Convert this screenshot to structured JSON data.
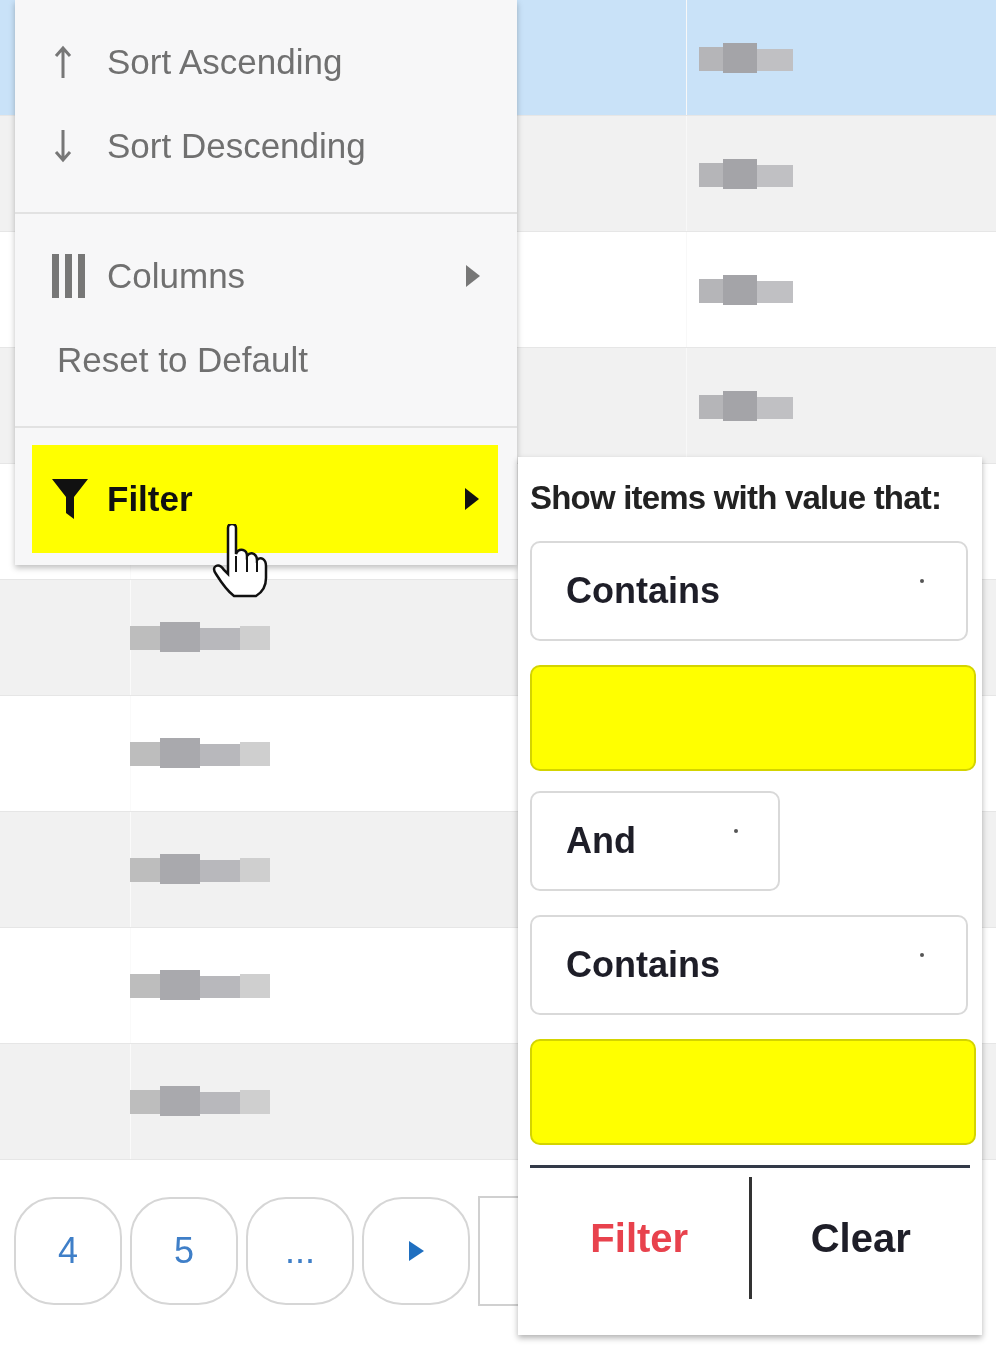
{
  "grid": {
    "rows": [
      {
        "selected": true
      },
      {
        "selected": false
      },
      {
        "selected": false
      },
      {
        "selected": false
      },
      {
        "selected": false
      },
      {
        "selected": false
      },
      {
        "selected": false
      },
      {
        "selected": false
      },
      {
        "selected": false
      },
      {
        "selected": false
      }
    ]
  },
  "column_menu": {
    "groups": [
      [
        {
          "kind": "ascending",
          "label": "Sort Ascending",
          "has_submenu": false,
          "highlighted": false
        },
        {
          "kind": "descending",
          "label": "Sort Descending",
          "has_submenu": false,
          "highlighted": false
        }
      ],
      [
        {
          "kind": "columns",
          "label": "Columns",
          "has_submenu": true,
          "highlighted": false
        },
        {
          "kind": "plain",
          "label": "Reset to Default",
          "has_submenu": false,
          "highlighted": false
        }
      ],
      [
        {
          "kind": "filter",
          "label": "Filter",
          "has_submenu": true,
          "highlighted": true
        }
      ]
    ]
  },
  "filter_panel": {
    "title": "Show items with value that:",
    "fields": [
      {
        "kind": "dropdown",
        "value": "Contains",
        "highlighted": false
      },
      {
        "kind": "input",
        "highlighted": true
      },
      {
        "kind": "logic",
        "value": "And",
        "highlighted": false
      },
      {
        "kind": "dropdown",
        "value": "Contains",
        "highlighted": false
      },
      {
        "kind": "input",
        "highlighted": true
      }
    ],
    "buttons": [
      {
        "label": "Filter",
        "kind": "primary"
      },
      {
        "label": "Clear",
        "kind": "secondary"
      }
    ]
  },
  "pager": {
    "pages": [
      {
        "label": "4"
      },
      {
        "label": "5"
      },
      {
        "label": "..."
      }
    ]
  }
}
